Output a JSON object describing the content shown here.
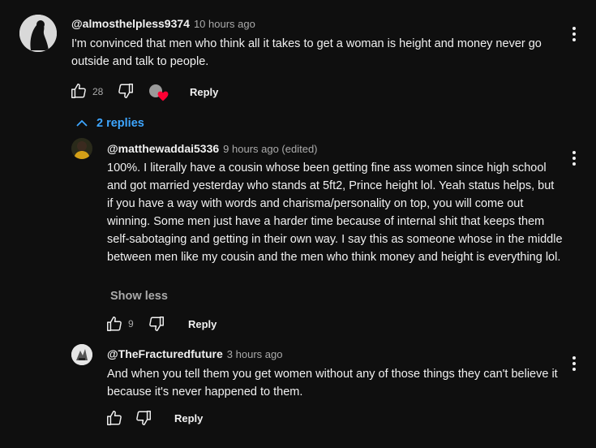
{
  "comments": [
    {
      "handle": "@almosthelpless9374",
      "time": "10 hours ago",
      "text": "I'm convinced that men who think all it takes to get a woman is height and money never go outside and talk to people.",
      "likes": "28",
      "reply_label": "Reply"
    }
  ],
  "replies_toggle": {
    "label": "2 replies"
  },
  "replies": [
    {
      "handle": "@matthewaddai5336",
      "time": "9 hours ago (edited)",
      "text": "100%. I literally have a cousin whose been getting fine ass women since high school and got married yesterday who stands at 5ft2, Prince height lol. Yeah status helps, but if you have a way with words and charisma/personality on top, you will come out winning. Some men just have a harder time because of internal shit that keeps them self-sabotaging and getting in their own way. I say this as someone whose in the middle between men like my cousin and the men who think money and height is everything lol.",
      "show_less": "Show less",
      "likes": "9",
      "reply_label": "Reply"
    },
    {
      "handle": "@TheFracturedfuture",
      "time": "3 hours ago",
      "text": "And when you tell them you get women without any of those things they can't believe it because it's never happened to them.",
      "likes": "",
      "reply_label": "Reply"
    }
  ],
  "colors": {
    "background": "#0f0f0f",
    "text": "#f1f1f1",
    "secondary": "#aaaaaa",
    "link_blue": "#3ea6ff",
    "heart": "#ff0033"
  }
}
